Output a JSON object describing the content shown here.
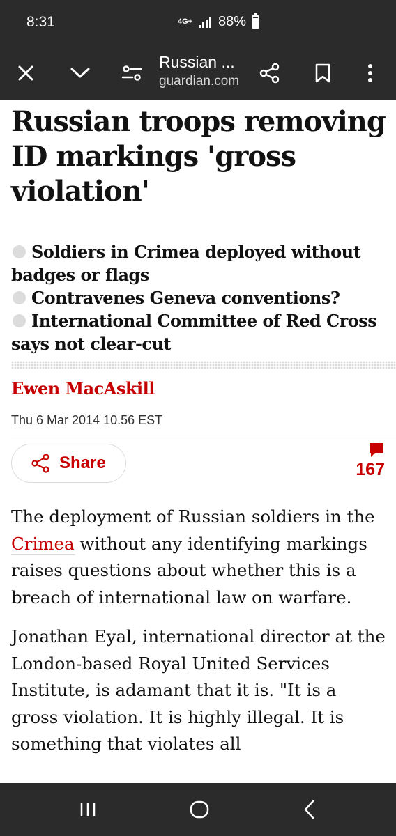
{
  "status_bar": {
    "time": "8:31",
    "network": "4G+",
    "battery": "88%"
  },
  "toolbar": {
    "title": "Russian ...",
    "url": "guardian.com",
    "icons": [
      "close-icon",
      "chevron-down-icon",
      "page-settings-icon",
      "share-icon",
      "bookmark-icon",
      "more-vert-icon"
    ]
  },
  "article": {
    "headline": "Russian troops removing ID markings 'gross violation'",
    "standfirst": [
      "Soldiers in Crimea deployed without badges or flags",
      "Contravenes Geneva conventions?",
      "International Committee of Red Cross says not clear-cut"
    ],
    "byline": "Ewen MacAskill",
    "date": "Thu 6 Mar 2014 10.56 EST",
    "share_label": "Share",
    "comment_count": "167",
    "paragraph1": {
      "before": "The deployment of Russian soldiers in the ",
      "link": "Crimea",
      "after": " without any identifying markings raises questions about whether this is a breach of international law on warfare."
    },
    "paragraph2": "Jonathan Eyal, international director at the London-based Royal United Services Institute, is adamant that it is. \"It is a gross violation. It is highly illegal. It is something that violates all"
  },
  "colors": {
    "accent_red": "#c70000",
    "chrome_dark": "#2b2b2b"
  },
  "nav_bar": {
    "icons": [
      "recent-apps-icon",
      "home-icon",
      "back-icon"
    ]
  }
}
